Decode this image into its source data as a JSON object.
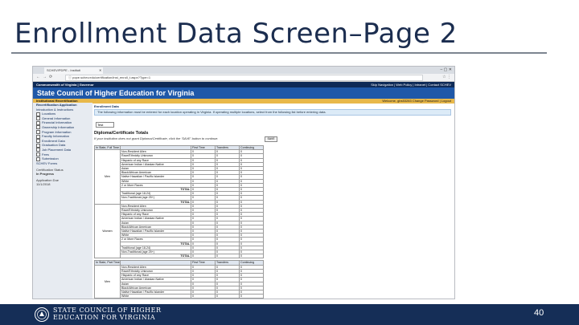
{
  "slide": {
    "title": "Enrollment Data Screen–Page 2",
    "page_number": "40",
    "footer_org_line1": "STATE COUNCIL OF HIGHER",
    "footer_org_line2": "EDUCATION FOR VIRGINIA"
  },
  "browser": {
    "tab_title": "SCHEV/PDPE - Institutional Recertification - Google Chrome",
    "tab_label": "SCHEV/PDPE - Instituti",
    "url": "ⓘ pope.schev.edu/certification/inst_enroll_t.aspx?Type=1"
  },
  "app": {
    "top_left": "Commonwealth of Virginia | Governor",
    "top_right": "Skip Navigation | Web Policy | Intranet | Contact SCHEV",
    "banner": "State Council of Higher Education for Virginia",
    "section": "Institutional Recertification",
    "welcome": "Welcome, gbs53283    Change Password | Logout"
  },
  "sidebar": {
    "items": [
      {
        "label": "Recertification Application",
        "box": false
      },
      {
        "label": "Introduction & Instructions",
        "box": false
      },
      {
        "label": "Locations",
        "box": true
      },
      {
        "label": "General Information",
        "box": true
      },
      {
        "label": "Financial Information",
        "box": true
      },
      {
        "label": "Ownership Information",
        "box": true
      },
      {
        "label": "Program Information",
        "box": true
      },
      {
        "label": "Faculty Information",
        "box": true
      },
      {
        "label": "Enrollment Data",
        "box": true
      },
      {
        "label": "Graduation Data",
        "box": true
      },
      {
        "label": "Job Placement Data",
        "box": true
      },
      {
        "label": "Fees",
        "box": true
      },
      {
        "label": "Submission",
        "box": true
      },
      {
        "label": "SCHEV Forms",
        "box": false
      }
    ],
    "status_label": "Certification Status",
    "status_value": "In Progress",
    "due_label": "Application Due",
    "due_value": "11/1/2018"
  },
  "main": {
    "enrollment_heading": "Enrollment Data",
    "info_text": "The following information must be entered for each location operating in Virginia. If operating multiple locations, select from the following list before entering data.",
    "location_select": "Test",
    "diploma_title": "Diploma/Certificate Totals",
    "diploma_note": "If your institution does not grant Diploma/Certificate, click the 'SAVE' button to continue.",
    "save_label": "SAVE",
    "table1": {
      "header": [
        "In State, Full Time",
        "",
        "First Time",
        "Transfers",
        "Continuing"
      ],
      "groups": [
        {
          "name": "Men",
          "rows": [
            "Non-Resident Alien",
            "Race/Ethnicity Unknown",
            "Hispanic of any Race",
            "American Indian / Alaskan Native",
            "Asian",
            "Black/African American",
            "Native Hawaiian / Pacific Islander",
            "White",
            "2 or More Races",
            "TOTAL",
            "Traditional (age 18-24)",
            "Non-Traditional (age 25+)",
            "TOTAL"
          ]
        },
        {
          "name": "Women",
          "rows": [
            "Non-Resident Alien",
            "Race/Ethnicity Unknown",
            "Hispanic of any Race",
            "American Indian / Alaskan Native",
            "Asian",
            "Black/African American",
            "Native Hawaiian / Pacific Islander",
            "White",
            "2 or More Races",
            "TOTAL",
            "Traditional (age 18-24)",
            "Non-Traditional (age 25+)",
            "TOTAL"
          ]
        }
      ]
    },
    "table2": {
      "header": [
        "In State, Part Time",
        "",
        "First Time",
        "Transfers",
        "Continuing"
      ],
      "groups": [
        {
          "name": "Men",
          "rows": [
            "Non-Resident Alien",
            "Race/Ethnicity Unknown",
            "Hispanic of any Race",
            "American Indian / Alaskan Native",
            "Asian",
            "Black/African American",
            "Native Hawaiian / Pacific Islander",
            "White"
          ]
        }
      ]
    },
    "cell_value": "0"
  },
  "colors": {
    "navy": "#152e57",
    "banner_blue": "#1f58a8",
    "gold": "#e8b84a"
  }
}
